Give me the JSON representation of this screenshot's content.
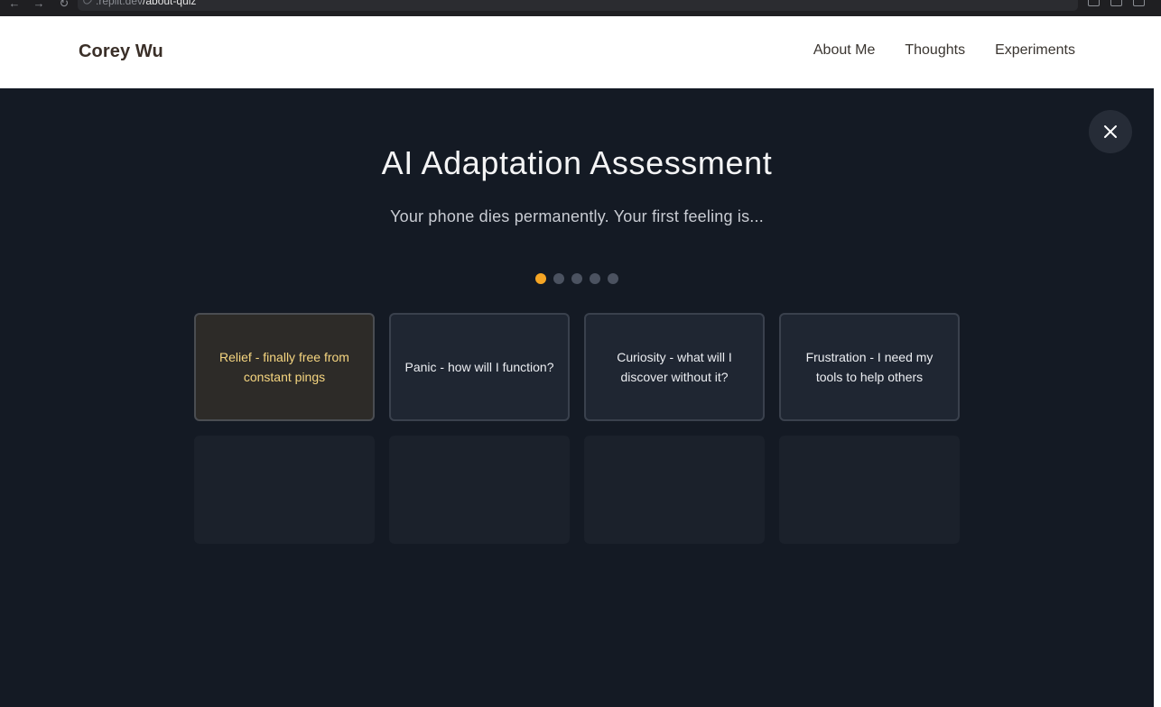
{
  "browser": {
    "url_domain": ".replit.dev",
    "url_path": "/about-quiz"
  },
  "header": {
    "brand": "Corey Wu",
    "nav": [
      {
        "label": "About Me"
      },
      {
        "label": "Thoughts"
      },
      {
        "label": "Experiments"
      }
    ]
  },
  "quiz": {
    "title": "AI Adaptation Assessment",
    "question": "Your phone dies permanently. Your first feeling is...",
    "progress": {
      "current": 1,
      "total": 5
    },
    "accent_color": "#f5a524",
    "options": [
      {
        "label": "Relief - finally free from constant pings",
        "selected": true
      },
      {
        "label": "Panic - how will I function?",
        "selected": false
      },
      {
        "label": "Curiosity - what will I discover without it?",
        "selected": false
      },
      {
        "label": "Frustration - I need my tools to help others",
        "selected": false
      }
    ],
    "placeholder_count": 4
  },
  "icons": {
    "close": "close-icon",
    "back": "arrow-left-icon",
    "forward": "arrow-right-icon",
    "reload": "reload-icon"
  }
}
